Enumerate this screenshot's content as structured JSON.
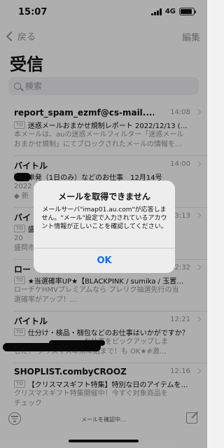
{
  "status_bar": {
    "time": "15:07",
    "network": "4G",
    "battery_level": 0.9
  },
  "nav": {
    "back_label": "戻る",
    "edit_label": "編集"
  },
  "title": "受信",
  "search": {
    "placeholder": "検索"
  },
  "mails": [
    {
      "sender": "report_spam_ezmf@cs-mail....",
      "date": "14:08",
      "tag": "TO",
      "subject": "迷惑メールおまかせ規制レポート 2022/12/13 (…",
      "preview_line1": "本メールは、auの迷惑メールフィルター「迷惑メール",
      "preview_line2": "おまかせ規制」にてブロックされたメールの情報を…"
    },
    {
      "sender": "バイトル",
      "date": "14:00",
      "tag": "TO",
      "subject": "単発（1日のみ）などのお仕事　12月14号",
      "preview_line1": "2022",
      "preview_line2": "◆ 新"
    },
    {
      "sender": "バイ",
      "date": "13:13",
      "tag": "TO",
      "subject": "盛",
      "preview_line1": "20",
      "preview_line2": "盛岡市"
    },
    {
      "sender": "ロー",
      "date": "12:32",
      "tag": "TO",
      "subject": "★当選確率UP★【BLACKPINK / sumika / 玉置…",
      "preview_line1": "ローチケHMVプレミアムなら プレリク抽選先行の当",
      "preview_line2": "選確率がアップ！..."
    },
    {
      "sender": "バイトル",
      "date": "12:21",
      "tag": "TO",
      "subject": "仕分け・検品・梱包などのお仕事はいかがですか？",
      "preview_line1": "　　　　　　　　　　お仕事をピックアップしま",
      "preview_line2": "した！ クリスマス年末年始まで！も OK★#激…"
    },
    {
      "sender": "SHOPLIST.combyCROOZ",
      "date": "12:16",
      "tag": "TO",
      "subject": "【クリスマスギフト特集】特別な日のアイテムを…",
      "preview_line1": "クリスマスギフト特集開催中！今すぐ対象商品を",
      "preview_line2": "チェック"
    }
  ],
  "alert": {
    "title": "メールを取得できません",
    "message": "メールサーバ\"imap01.au.com\"が応答しません。\"メール\"設定で入力されているアカウント情報が正しいことを確認してください。",
    "ok_label": "OK"
  },
  "toolbar": {
    "status_text": "メールを確認中..."
  }
}
